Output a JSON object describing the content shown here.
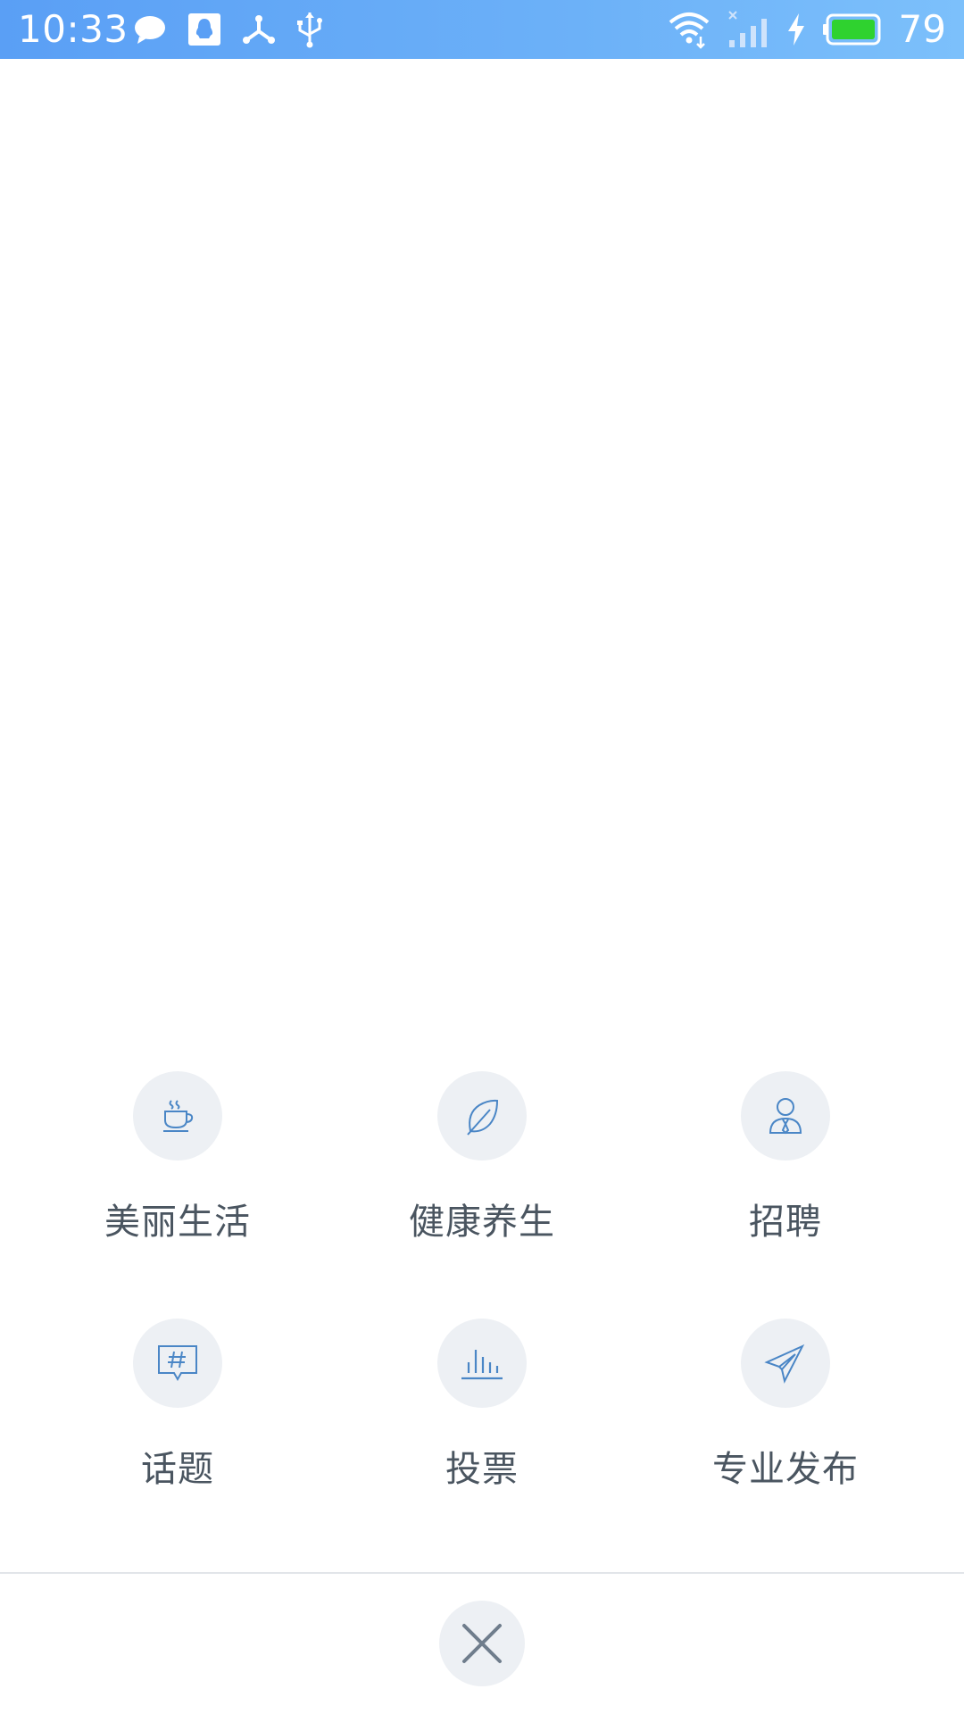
{
  "status_bar": {
    "time": "10:33",
    "battery_percent": "79",
    "left_icons": [
      "chat-bubble-icon",
      "qq-penguin-icon",
      "share-nodes-icon",
      "usb-icon"
    ],
    "right_icons": [
      "wifi-icon",
      "cellular-signal-icon",
      "charging-bolt-icon",
      "battery-icon"
    ]
  },
  "menu": {
    "items": [
      {
        "label": "美丽生活",
        "icon": "coffee-cup-icon"
      },
      {
        "label": "健康养生",
        "icon": "leaf-icon"
      },
      {
        "label": "招聘",
        "icon": "person-tie-icon"
      },
      {
        "label": "话题",
        "icon": "hashtag-bubble-icon"
      },
      {
        "label": "投票",
        "icon": "bar-chart-icon"
      },
      {
        "label": "专业发布",
        "icon": "paper-plane-icon"
      }
    ]
  },
  "colors": {
    "status_bar": "#6cb1f8",
    "icon_blue": "#4a86c6",
    "circle_bg": "#edf0f4",
    "label_text": "#4a5560"
  }
}
